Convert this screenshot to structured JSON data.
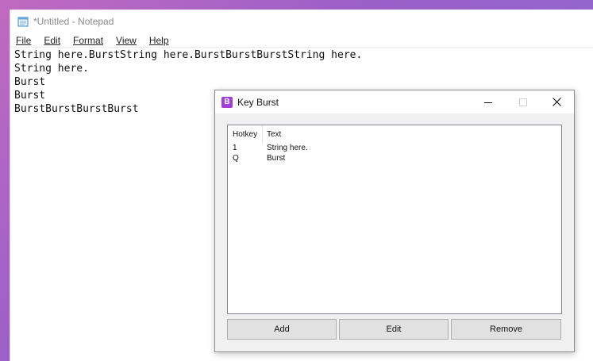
{
  "notepad": {
    "title": "*Untitled - Notepad",
    "menu": [
      {
        "label": "File"
      },
      {
        "label": "Edit"
      },
      {
        "label": "Format"
      },
      {
        "label": "View"
      },
      {
        "label": "Help"
      }
    ],
    "text": "String here.BurstString here.BurstBurstBurstString here.\nString here.\nBurst\nBurst\nBurstBurstBurstBurst"
  },
  "dialog": {
    "title": "Key Burst",
    "logo_letter": "B",
    "accent": "#a23fd6",
    "columns": {
      "hotkey": "Hotkey",
      "text": "Text"
    },
    "rows": [
      {
        "hotkey": "1",
        "text": "String here."
      },
      {
        "hotkey": "Q",
        "text": "Burst"
      }
    ],
    "buttons": {
      "add": "Add",
      "edit": "Edit",
      "remove": "Remove"
    }
  }
}
